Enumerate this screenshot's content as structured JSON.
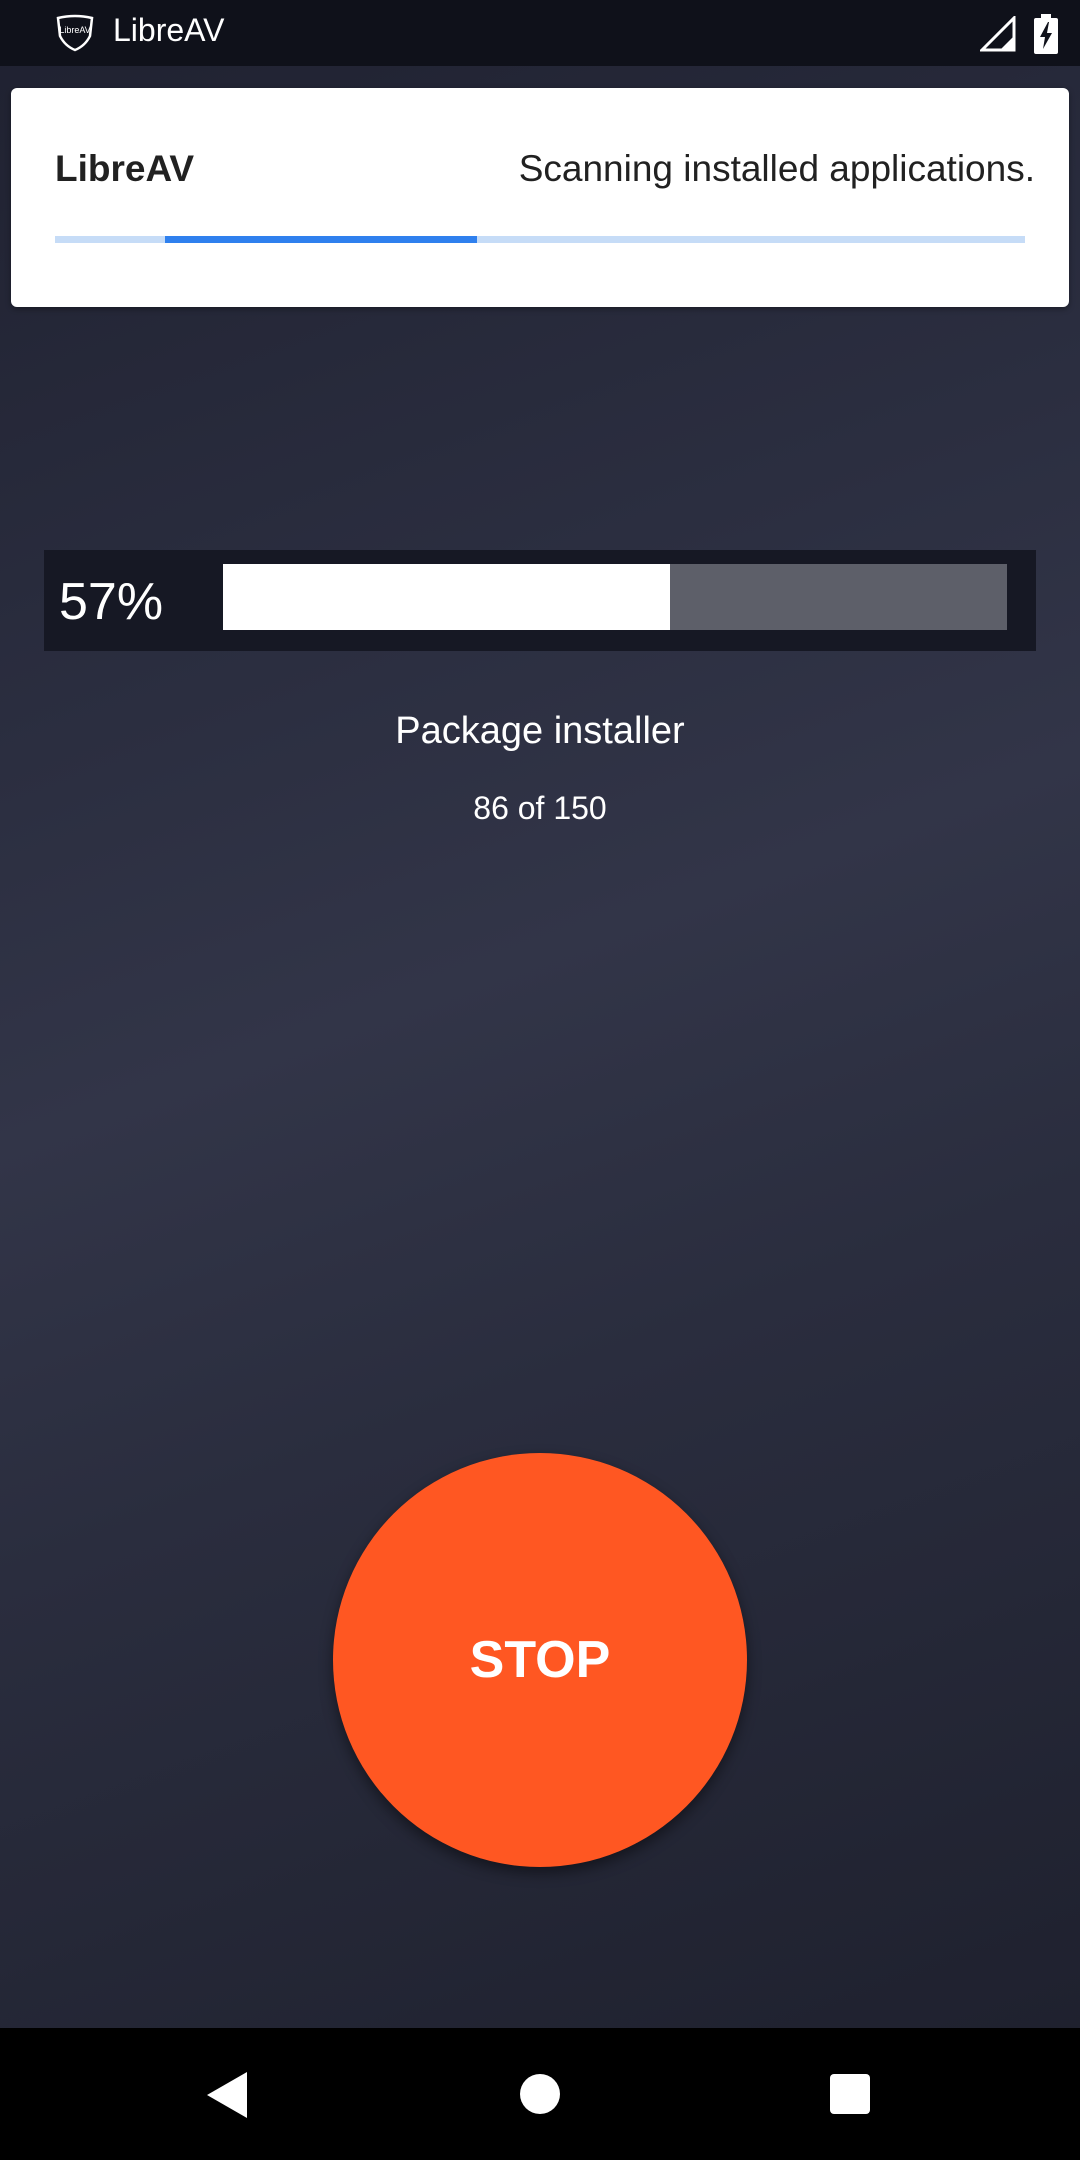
{
  "status_bar": {
    "app_icon": "shield-logo-icon",
    "app_icon_text": "LibreAV",
    "title": "LibreAV",
    "icons": [
      "signal-icon",
      "battery-charging-icon"
    ]
  },
  "notification": {
    "app_name": "LibreAV",
    "message": "Scanning installed applications.",
    "accent_color": "#2f80ee"
  },
  "scan": {
    "percent_label": "57%",
    "progress": 0.57,
    "current_package": "Package installer",
    "count_label": "86 of 150"
  },
  "stop_button": {
    "label": "STOP",
    "color": "#ff5722"
  },
  "nav_bar": {
    "icons": [
      "back-icon",
      "home-icon",
      "recents-icon"
    ]
  }
}
